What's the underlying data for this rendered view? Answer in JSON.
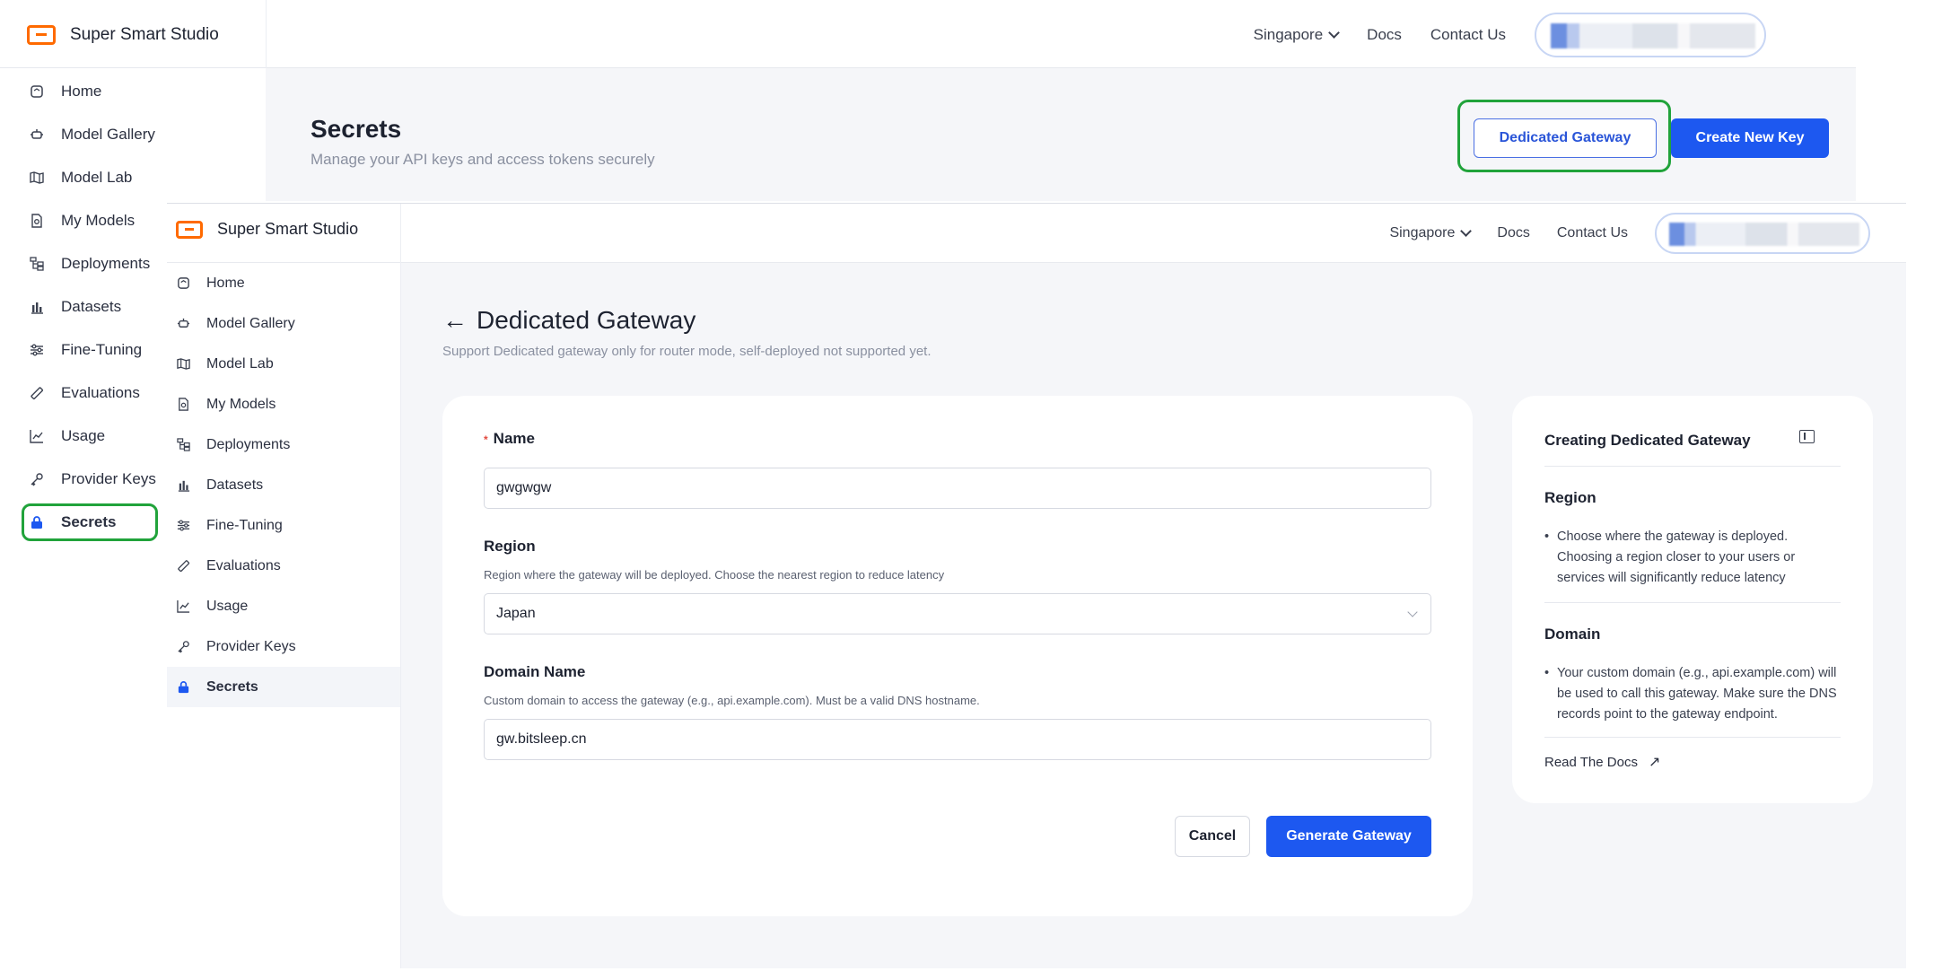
{
  "back": {
    "brand": "Super Smart Studio",
    "topnav": {
      "region": "Singapore",
      "docs": "Docs",
      "contact": "Contact Us"
    },
    "header": {
      "title": "Secrets",
      "subtitle": "Manage your API keys and access tokens securely",
      "dedicated_gateway_btn": "Dedicated Gateway",
      "create_key_btn": "Create New Key"
    },
    "sidebar": [
      {
        "label": "Home",
        "icon": "home-icon"
      },
      {
        "label": "Model Gallery",
        "icon": "robot-icon"
      },
      {
        "label": "Model Lab",
        "icon": "map-icon"
      },
      {
        "label": "My Models",
        "icon": "model-file-icon"
      },
      {
        "label": "Deployments",
        "icon": "deploy-tree-icon"
      },
      {
        "label": "Datasets",
        "icon": "bar-chart-icon"
      },
      {
        "label": "Fine-Tuning",
        "icon": "sliders-icon"
      },
      {
        "label": "Evaluations",
        "icon": "ruler-icon"
      },
      {
        "label": "Usage",
        "icon": "line-chart-icon"
      },
      {
        "label": "Provider Keys",
        "icon": "key-icon"
      },
      {
        "label": "Secrets",
        "icon": "lock-icon",
        "active": true
      }
    ]
  },
  "front": {
    "brand": "Super Smart Studio",
    "topnav": {
      "region": "Singapore",
      "docs": "Docs",
      "contact": "Contact Us"
    },
    "sidebar": [
      {
        "label": "Home",
        "icon": "home-icon"
      },
      {
        "label": "Model Gallery",
        "icon": "robot-icon"
      },
      {
        "label": "Model Lab",
        "icon": "map-icon"
      },
      {
        "label": "My Models",
        "icon": "model-file-icon"
      },
      {
        "label": "Deployments",
        "icon": "deploy-tree-icon"
      },
      {
        "label": "Datasets",
        "icon": "bar-chart-icon"
      },
      {
        "label": "Fine-Tuning",
        "icon": "sliders-icon"
      },
      {
        "label": "Evaluations",
        "icon": "ruler-icon"
      },
      {
        "label": "Usage",
        "icon": "line-chart-icon"
      },
      {
        "label": "Provider Keys",
        "icon": "key-icon"
      },
      {
        "label": "Secrets",
        "icon": "lock-icon",
        "active": true
      }
    ],
    "page": {
      "title": "Dedicated Gateway",
      "subtitle": "Support Dedicated gateway only for router mode, self-deployed not supported yet."
    },
    "form": {
      "name_label": "Name",
      "name_required_mark": "*",
      "name_value": "gwgwgw",
      "region_label": "Region",
      "region_help": "Region where the gateway will be deployed. Choose the nearest region to reduce latency",
      "region_value": "Japan",
      "domain_label": "Domain Name",
      "domain_help": "Custom domain to access the gateway (e.g., api.example.com). Must be a valid DNS hostname.",
      "domain_value": "gw.bitsleep.cn",
      "cancel_btn": "Cancel",
      "generate_btn": "Generate Gateway"
    },
    "help": {
      "title": "Creating Dedicated Gateway",
      "region_heading": "Region",
      "region_text": "Choose where the gateway is deployed. Choosing a region closer to your users or services will significantly reduce latency",
      "domain_heading": "Domain",
      "domain_text": "Your custom domain (e.g., api.example.com) will be used to call this gateway. Make sure the DNS records point to the gateway endpoint.",
      "docs_link": "Read The Docs"
    }
  },
  "colors": {
    "accent": "#1d58f0",
    "brand": "#ff6a00",
    "highlight": "#21a33b",
    "required": "#e2483d"
  }
}
